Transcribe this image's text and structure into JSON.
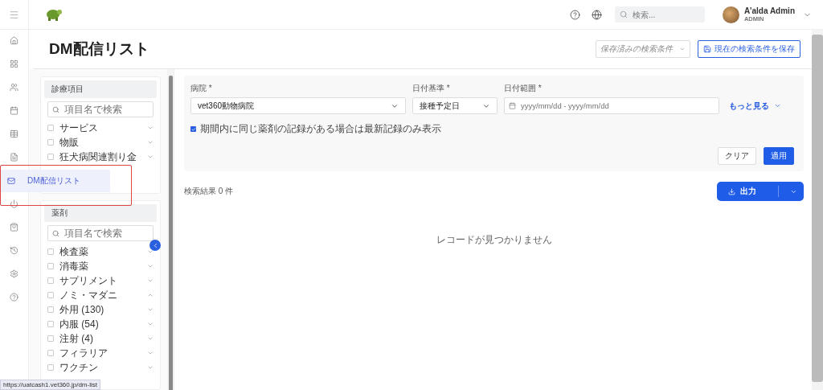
{
  "header": {
    "search_placeholder": "検索...",
    "user": {
      "name": "A'alda Admin",
      "role": "ADMIN"
    }
  },
  "tooltip": {
    "label": "DM配信リスト"
  },
  "page": {
    "title": "DM配信リスト",
    "saved_search": {
      "placeholder": "保存済みの検索条件"
    },
    "save_button": "現在の検索条件を保存"
  },
  "filter_groups": [
    {
      "title": "診療項目",
      "search_placeholder": "項目名で検索",
      "items": [
        {
          "label": "サービス",
          "checked": false,
          "expanded": false
        },
        {
          "label": "物販",
          "checked": false,
          "expanded": false
        },
        {
          "label": "狂犬病関連割り金",
          "checked": false,
          "expanded": false
        }
      ]
    },
    {
      "title": "薬剤",
      "search_placeholder": "項目名で検索",
      "items": [
        {
          "label": "検査薬",
          "checked": false,
          "expanded": false
        },
        {
          "label": "消毒薬",
          "checked": false,
          "expanded": false
        },
        {
          "label": "サプリメント",
          "checked": false,
          "expanded": false
        },
        {
          "label": "ノミ・マダニ",
          "checked": false,
          "expanded": true
        },
        {
          "label": "外用 (130)",
          "checked": false,
          "expanded": false
        },
        {
          "label": "内服 (54)",
          "checked": false,
          "expanded": false
        },
        {
          "label": "注射 (4)",
          "checked": false,
          "expanded": false
        },
        {
          "label": "フィラリア",
          "checked": false,
          "expanded": false
        },
        {
          "label": "ワクチン",
          "checked": false,
          "expanded": false
        }
      ]
    }
  ],
  "filters": {
    "fields": [
      {
        "kind": "select",
        "label": "病院 *",
        "value": "vet360動物病院"
      },
      {
        "kind": "select",
        "label": "日付基準 *",
        "value": "接種予定日"
      },
      {
        "kind": "date",
        "label": "日付範囲 *",
        "placeholder": "yyyy/mm/dd - yyyy/mm/dd"
      }
    ],
    "more": "もっと見る",
    "latest_only": {
      "label": "期間内に同じ薬剤の記録がある場合は最新記録のみ表示",
      "checked": true
    },
    "clear": "クリア",
    "apply": "適用"
  },
  "results": {
    "count": "検索結果 0 件",
    "export": "出力",
    "empty": "レコードが見つかりません"
  },
  "status_url": "https://uatcash1.vet360.jp/dm-list"
}
